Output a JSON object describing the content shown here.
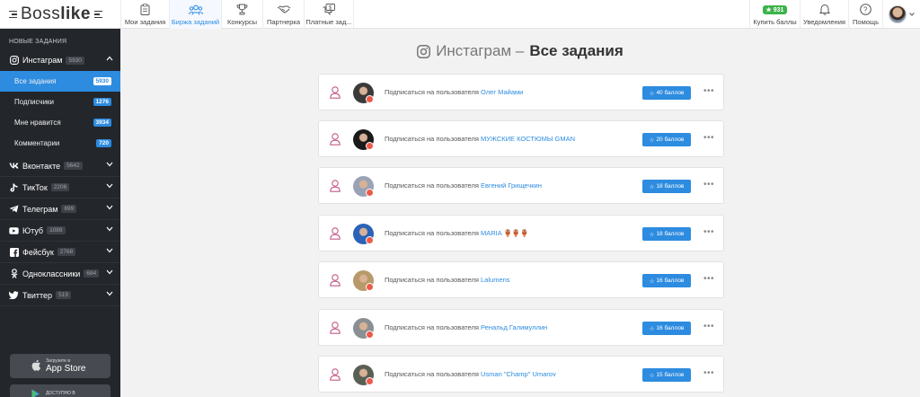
{
  "logo": {
    "part1": "Boss",
    "part2": "like"
  },
  "nav": [
    {
      "label": "Мои задания",
      "icon": "clipboard-icon"
    },
    {
      "label": "Биржа заданий",
      "icon": "people-icon"
    },
    {
      "label": "Конкурсы",
      "icon": "trophy-icon"
    },
    {
      "label": "Партнерка",
      "icon": "handshake-icon"
    },
    {
      "label": "Платные зад...",
      "icon": "paid-chat-icon"
    }
  ],
  "header_right": {
    "points": "931",
    "buy": "Купить баллы",
    "notifications": "Уведомления",
    "help": "Помощь"
  },
  "sidebar": {
    "heading": "НОВЫЕ ЗАДАНИЯ",
    "instagram": {
      "label": "Инстаграм",
      "count": "5930"
    },
    "sub": [
      {
        "label": "Все задания",
        "count": "5930"
      },
      {
        "label": "Подписчики",
        "count": "1276"
      },
      {
        "label": "Мне нравится",
        "count": "3934"
      },
      {
        "label": "Комментарии",
        "count": "720"
      }
    ],
    "groups": [
      {
        "label": "Вконтакте",
        "count": "5642",
        "icon": "vk-icon"
      },
      {
        "label": "ТикТок",
        "count": "2206",
        "icon": "tiktok-icon"
      },
      {
        "label": "Телеграм",
        "count": "699",
        "icon": "telegram-icon"
      },
      {
        "label": "Ютуб",
        "count": "1089",
        "icon": "youtube-icon"
      },
      {
        "label": "Фейсбук",
        "count": "2768",
        "icon": "facebook-icon"
      },
      {
        "label": "Одноклассники",
        "count": "684",
        "icon": "odnoklassniki-icon"
      },
      {
        "label": "Твиттер",
        "count": "519",
        "icon": "twitter-icon"
      }
    ],
    "appstore": {
      "small": "Загрузите в",
      "big": "App Store"
    },
    "googleplay": {
      "small": "ДОСТУПНО В"
    }
  },
  "main": {
    "title_prefix": "Инстаграм –",
    "title_bold": "Все задания",
    "action_text": "Подписаться на пользователя",
    "tasks": [
      {
        "user": "Олег Майами",
        "points": "40 баллов",
        "avatar_color": "#3a3a3a"
      },
      {
        "user": "МУЖСКИЕ КОСТЮМЫ GMAN",
        "points": "20 баллов",
        "avatar_color": "#1a1a1a"
      },
      {
        "user": "Евгений Грищечкин",
        "points": "18 баллов",
        "avatar_color": "#9aa3b5"
      },
      {
        "user": "MARIA 🏺🏺🏺",
        "points": "18 баллов",
        "avatar_color": "#2a63b8"
      },
      {
        "user": "Lalumens",
        "points": "16 баллов",
        "avatar_color": "#b89a6a"
      },
      {
        "user": "Ренальд Галимуллин",
        "points": "16 баллов",
        "avatar_color": "#8a8f94"
      },
      {
        "user": "Usman \"Champ\" Umarov",
        "points": "15 баллов",
        "avatar_color": "#5a5f54"
      }
    ]
  }
}
